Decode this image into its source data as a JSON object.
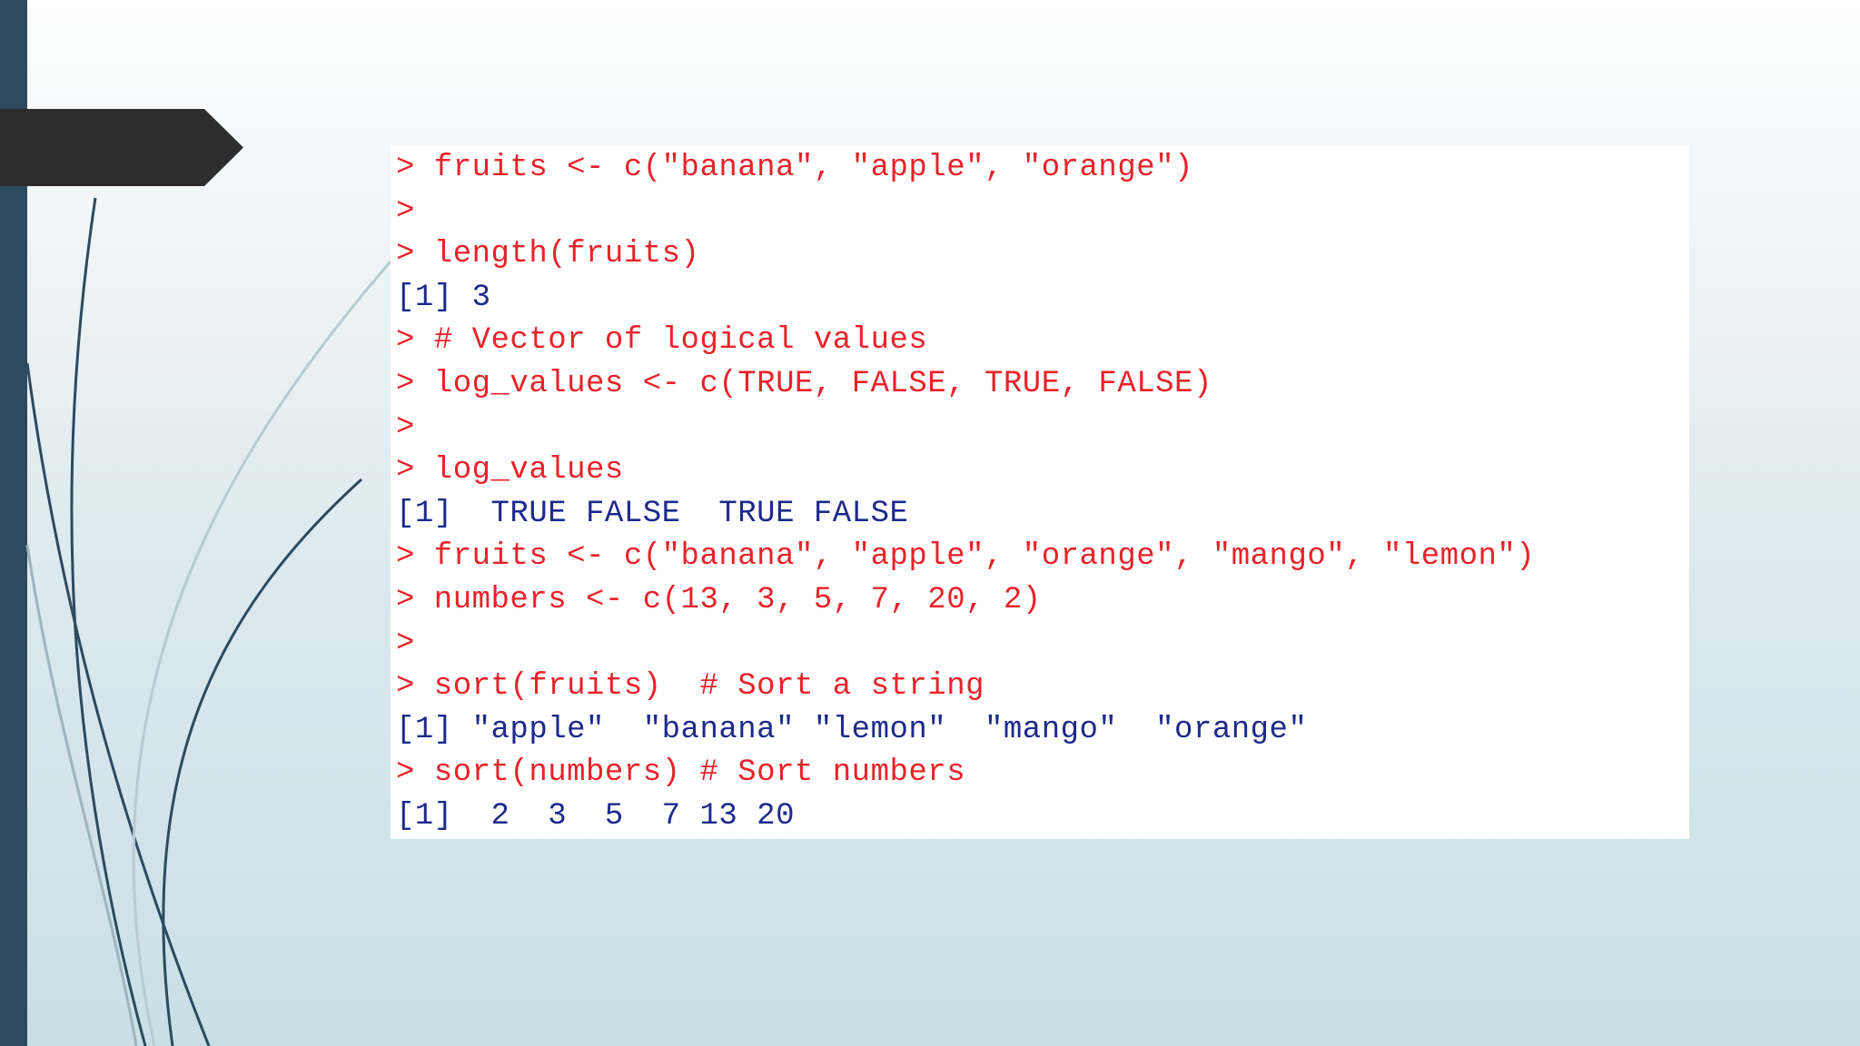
{
  "console": {
    "lines": [
      {
        "type": "input",
        "text": "> fruits <- c(\"banana\", \"apple\", \"orange\")"
      },
      {
        "type": "input",
        "text": ">"
      },
      {
        "type": "input",
        "text": "> length(fruits)"
      },
      {
        "type": "output",
        "text": "[1] 3"
      },
      {
        "type": "input",
        "text": "> # Vector of logical values"
      },
      {
        "type": "input",
        "text": "> log_values <- c(TRUE, FALSE, TRUE, FALSE)"
      },
      {
        "type": "input",
        "text": ">"
      },
      {
        "type": "input",
        "text": "> log_values"
      },
      {
        "type": "output",
        "text": "[1]  TRUE FALSE  TRUE FALSE"
      },
      {
        "type": "input",
        "text": "> fruits <- c(\"banana\", \"apple\", \"orange\", \"mango\", \"lemon\")"
      },
      {
        "type": "input",
        "text": "> numbers <- c(13, 3, 5, 7, 20, 2)"
      },
      {
        "type": "input",
        "text": ">"
      },
      {
        "type": "input",
        "text": "> sort(fruits)  # Sort a string"
      },
      {
        "type": "output",
        "text": "[1] \"apple\"  \"banana\" \"lemon\"  \"mango\"  \"orange\""
      },
      {
        "type": "input",
        "text": "> sort(numbers) # Sort numbers"
      },
      {
        "type": "output",
        "text": "[1]  2  3  5  7 13 20"
      }
    ]
  },
  "colors": {
    "input": "#e8232a",
    "output": "#1e2a8c",
    "sidebar": "#2c4a60",
    "arrow_tab": "#2d2d2d"
  }
}
